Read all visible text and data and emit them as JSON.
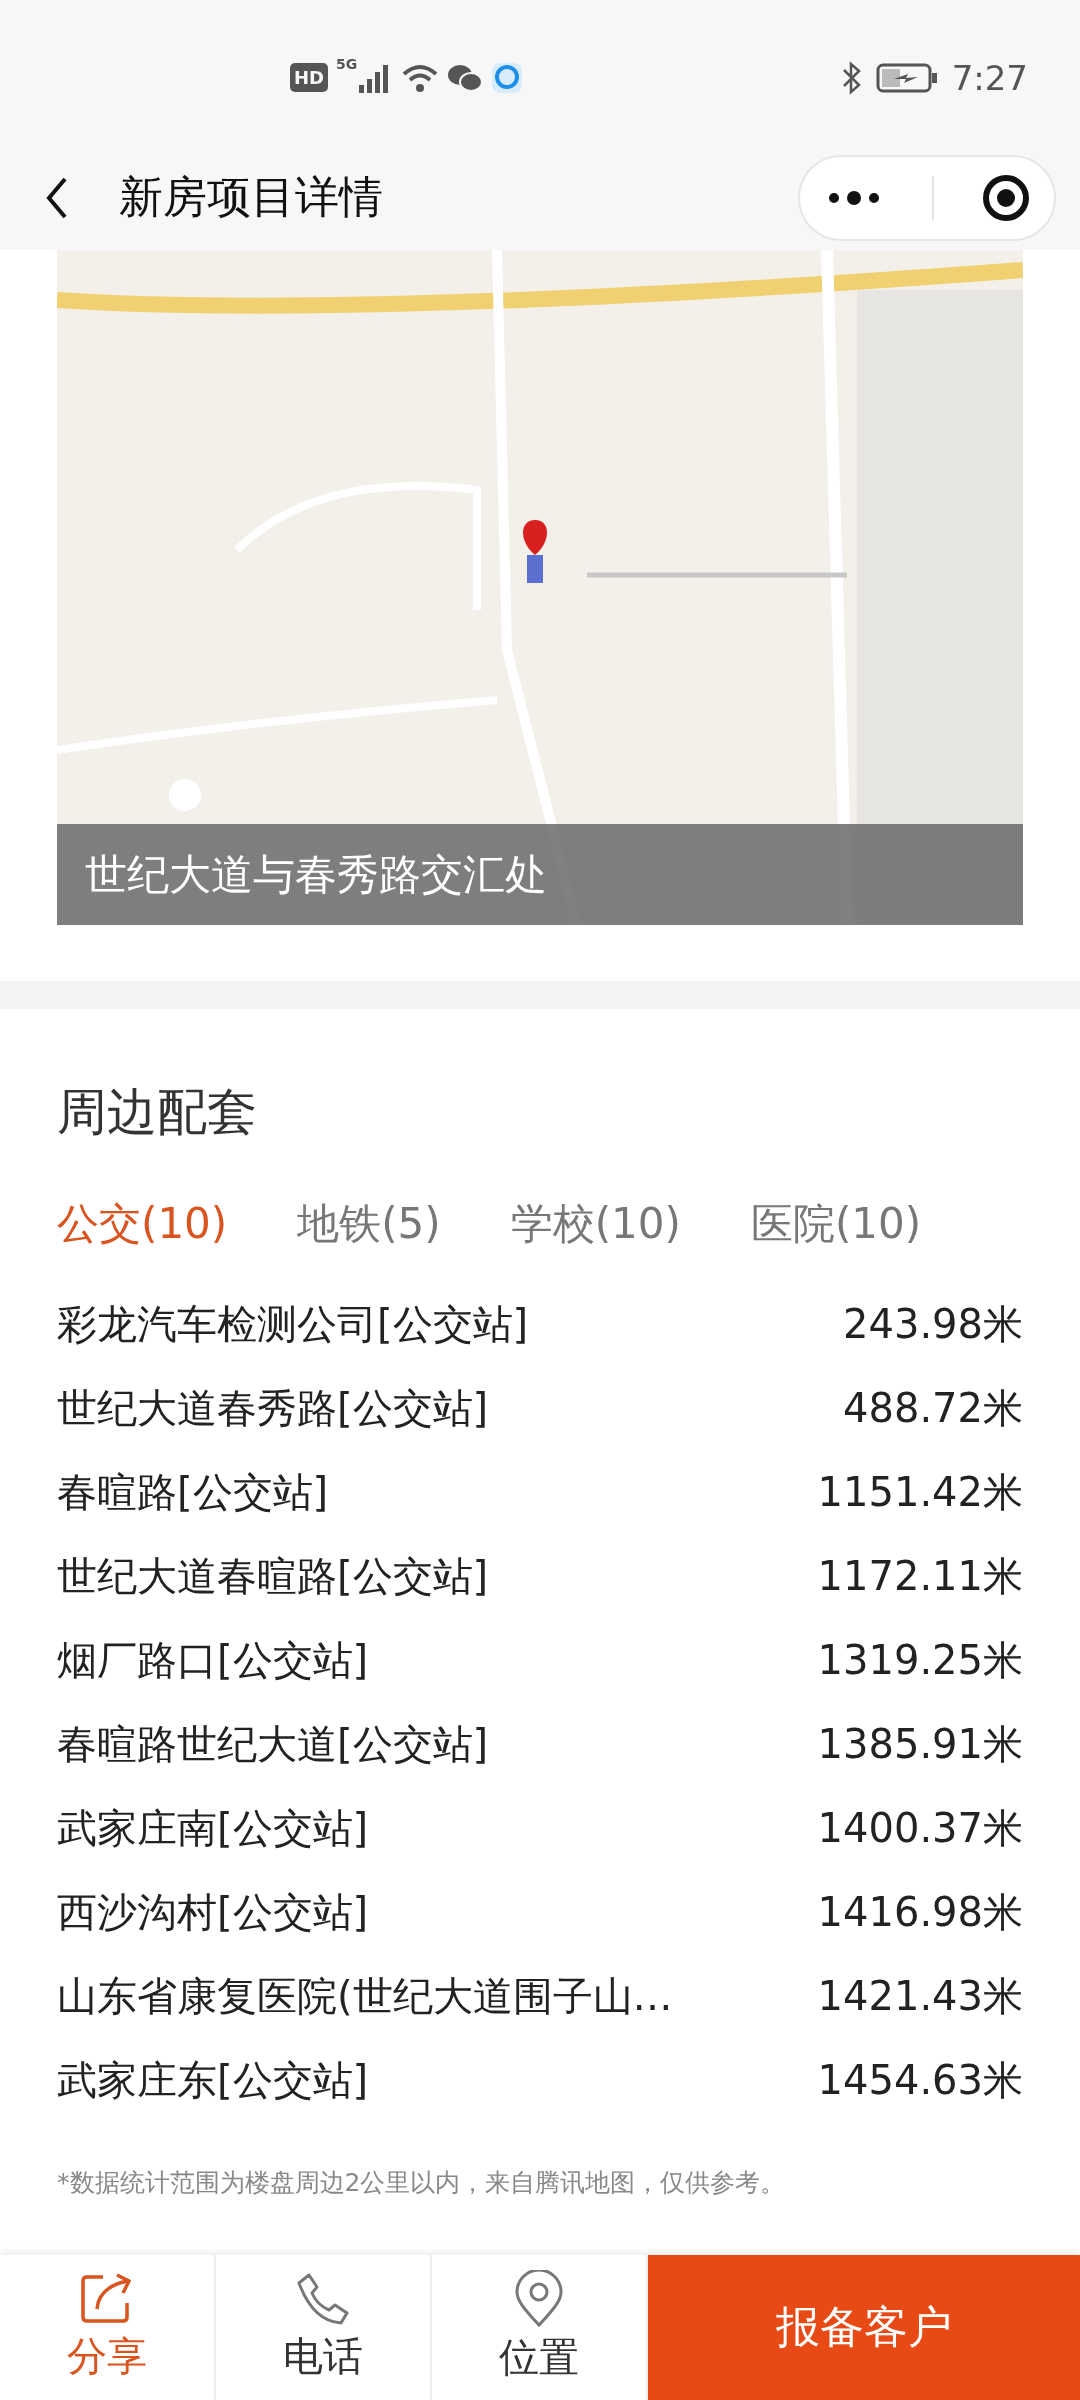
{
  "status_bar": {
    "hd": "HD",
    "network": "5G",
    "time": "7:27"
  },
  "header": {
    "title": "新房项目详情"
  },
  "map": {
    "kind": "picture",
    "caption": "世纪大道与春秀路交汇处"
  },
  "nearby": {
    "title": "周边配套",
    "tabs": [
      {
        "label": "公交(10)",
        "selected": true
      },
      {
        "label": "地铁(5)",
        "selected": false
      },
      {
        "label": "学校(10)",
        "selected": false
      },
      {
        "label": "医院(10)",
        "selected": false
      }
    ],
    "rows": [
      {
        "name": "彩龙汽车检测公司[公交站]",
        "distance": "243.98米"
      },
      {
        "name": "世纪大道春秀路[公交站]",
        "distance": "488.72米"
      },
      {
        "name": "春暄路[公交站]",
        "distance": "1151.42米"
      },
      {
        "name": "世纪大道春暄路[公交站]",
        "distance": "1172.11米"
      },
      {
        "name": "烟厂路口[公交站]",
        "distance": "1319.25米"
      },
      {
        "name": "春暄路世纪大道[公交站]",
        "distance": "1385.91米"
      },
      {
        "name": "武家庄南[公交站]",
        "distance": "1400.37米"
      },
      {
        "name": "西沙沟村[公交站]",
        "distance": "1416.98米"
      },
      {
        "name": "山东省康复医院(世纪大道围子山…",
        "distance": "1421.43米"
      },
      {
        "name": "武家庄东[公交站]",
        "distance": "1454.63米"
      }
    ],
    "note": "*数据统计范围为楼盘周边2公里以内，来自腾讯地图，仅供参考。"
  },
  "bottom_bar": {
    "actions": [
      {
        "kind": "share",
        "label": "分享",
        "selected": true
      },
      {
        "kind": "phone",
        "label": "电话",
        "selected": false
      },
      {
        "kind": "location",
        "label": "位置",
        "selected": false
      }
    ],
    "primary": "报备客户"
  }
}
